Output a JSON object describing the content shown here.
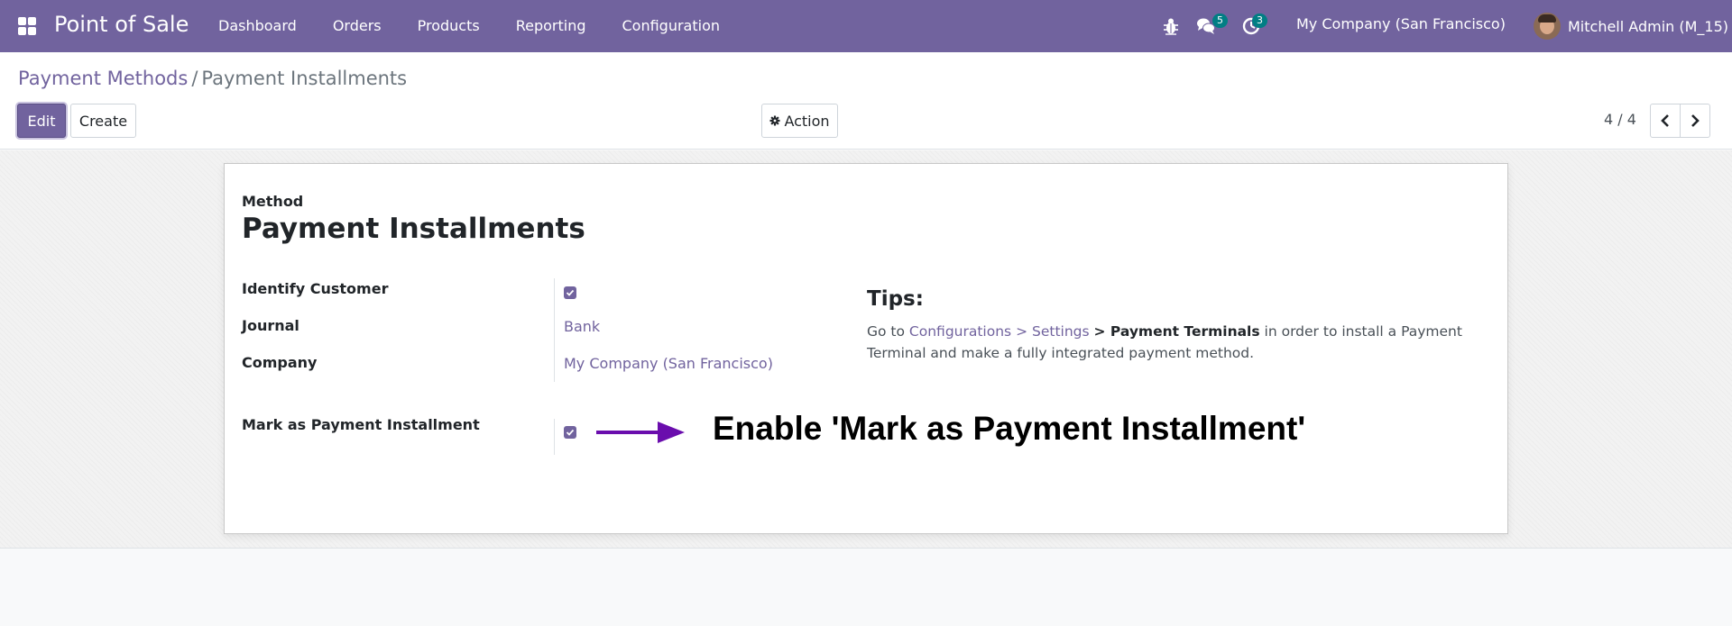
{
  "navbar": {
    "brand": "Point of Sale",
    "menu": [
      "Dashboard",
      "Orders",
      "Products",
      "Reporting",
      "Configuration"
    ],
    "messages_count": "5",
    "activities_count": "3",
    "company": "My Company (San Francisco)",
    "user": "Mitchell Admin (M_15)",
    "colors": {
      "primary": "#71639e",
      "badge": "#017e84"
    }
  },
  "breadcrumb": {
    "parent": "Payment Methods",
    "separator": "/",
    "current": "Payment Installments"
  },
  "toolbar": {
    "edit_label": "Edit",
    "create_label": "Create",
    "action_label": "Action",
    "pager": "4 / 4"
  },
  "form": {
    "method_label": "Method",
    "name": "Payment Installments",
    "fields": {
      "identify_customer": {
        "label": "Identify Customer",
        "checked": true
      },
      "journal": {
        "label": "Journal",
        "value": "Bank"
      },
      "company": {
        "label": "Company",
        "value": "My Company (San Francisco)"
      },
      "mark_installment": {
        "label": "Mark as Payment Installment",
        "checked": true
      }
    },
    "tips": {
      "title": "Tips:",
      "prefix": "Go to",
      "link1": "Configurations",
      "gt1": ">",
      "link2": "Settings",
      "bold": "> Payment Terminals",
      "suffix": "in order to install a Payment Terminal and make a fully integrated payment method."
    }
  },
  "annotation": {
    "text": "Enable 'Mark as Payment Installment'",
    "arrow_color": "#6a0dad"
  }
}
